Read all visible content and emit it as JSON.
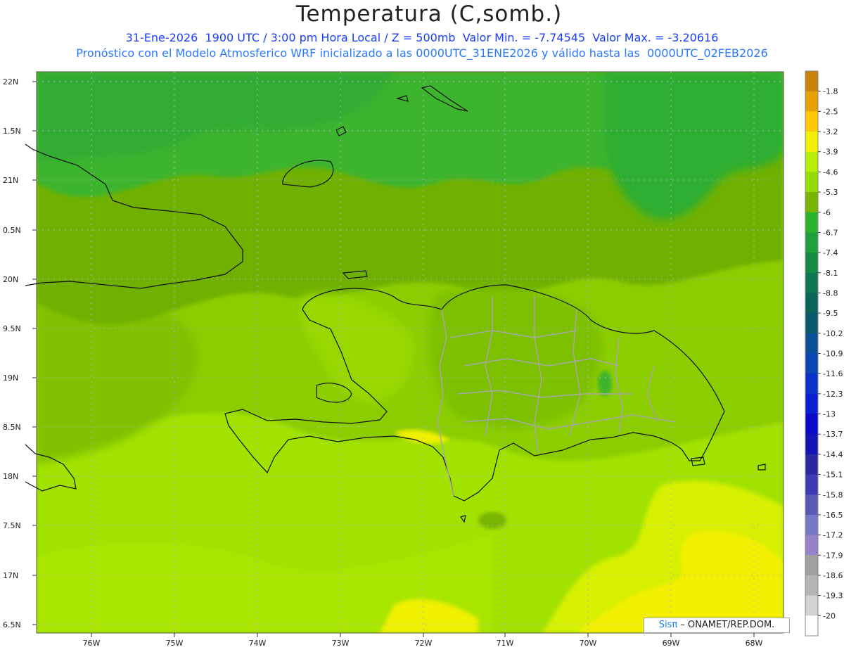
{
  "title": "Temperatura (C,somb.)",
  "subtitle1": "31-Ene-2026  1900 UTC / 3:00 pm Hora Local / Z = 500mb  Valor Min. = -7.74545  Valor Max. = -3.20616",
  "subtitle2": "Pronóstico con el Modelo Atmosferico WRF inicializado a las 0000UTC_31ENE2026 y válido hasta las  0000UTC_02FEB2026",
  "credit": {
    "brand": "Sisπ",
    "text": " – ONAMET/REP.DOM."
  },
  "axes": {
    "lat_labels": [
      "22N",
      "1.5N",
      "21N",
      "0.5N",
      "20N",
      "9.5N",
      "19N",
      "8.5N",
      "18N",
      "7.5N",
      "17N",
      "6.5N"
    ],
    "lon_labels": [
      "76W",
      "75W",
      "74W",
      "73W",
      "72W",
      "71W",
      "70W",
      "69W",
      "68W"
    ]
  },
  "colorbar": {
    "labels": [
      "-1.8",
      "-2.5",
      "-3.2",
      "-3.9",
      "-4.6",
      "-5.3",
      "-6",
      "-6.7",
      "-7.4",
      "-8.1",
      "-8.8",
      "-9.5",
      "-10.2",
      "-10.9",
      "-11.6",
      "-12.3",
      "-13",
      "-13.7",
      "-14.4",
      "-15.1",
      "-15.8",
      "-16.5",
      "-17.2",
      "-17.9",
      "-18.6",
      "-19.3",
      "-20"
    ],
    "colors": [
      "#c8820a",
      "#e6a000",
      "#ffc800",
      "#f0f000",
      "#b4f000",
      "#96dc00",
      "#78b400",
      "#2db42d",
      "#1ea03c",
      "#148c46",
      "#0f7850",
      "#0a645a",
      "#0a5a6e",
      "#0a5096",
      "#0a46b4",
      "#0a32c8",
      "#0a1ed2",
      "#0a0ac8",
      "#1414b4",
      "#2828a0",
      "#3c3cb4",
      "#5a5ab4",
      "#7878c8",
      "#9682c8",
      "#a0a0a0",
      "#b4b4b4",
      "#d2d2d2",
      "#ffffff"
    ]
  }
}
